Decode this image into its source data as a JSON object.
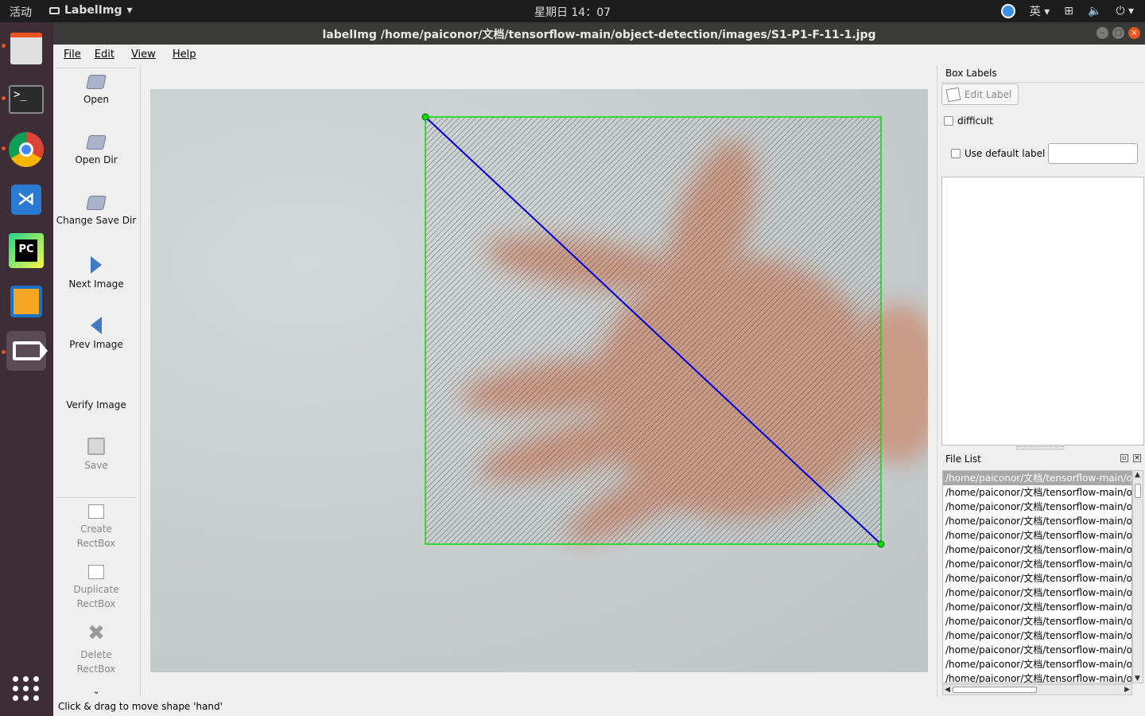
{
  "system": {
    "activities": "活动",
    "app_name": "LabelImg",
    "clock": "星期日 14：07",
    "input_method": "英"
  },
  "window": {
    "title": "labelImg /home/paiconor/文档/tensorflow-main/object-detection/images/S1-P1-F-11-1.jpg"
  },
  "menu": {
    "file": "File",
    "edit": "Edit",
    "view": "View",
    "help": "Help"
  },
  "toolbar": {
    "open": "Open",
    "open_dir": "Open Dir",
    "change_save_dir": "Change Save Dir",
    "next_image": "Next Image",
    "prev_image": "Prev Image",
    "verify_image": "Verify Image",
    "save": "Save",
    "create_rectbox_1": "Create",
    "create_rectbox_2": "RectBox",
    "duplicate_rectbox_1": "Duplicate",
    "duplicate_rectbox_2": "RectBox",
    "delete_rectbox_1": "Delete",
    "delete_rectbox_2": "RectBox",
    "more": "⌄"
  },
  "box_labels": {
    "title": "Box Labels",
    "edit_label": "Edit Label",
    "difficult": "difficult",
    "use_default_label": "Use default label",
    "default_label_value": ""
  },
  "file_list": {
    "title": "File List",
    "items": [
      "/home/paiconor/文档/tensorflow-main/ob",
      "/home/paiconor/文档/tensorflow-main/ob",
      "/home/paiconor/文档/tensorflow-main/ob",
      "/home/paiconor/文档/tensorflow-main/ob",
      "/home/paiconor/文档/tensorflow-main/ob",
      "/home/paiconor/文档/tensorflow-main/ob",
      "/home/paiconor/文档/tensorflow-main/ob",
      "/home/paiconor/文档/tensorflow-main/ob",
      "/home/paiconor/文档/tensorflow-main/ob",
      "/home/paiconor/文档/tensorflow-main/ob",
      "/home/paiconor/文档/tensorflow-main/ob",
      "/home/paiconor/文档/tensorflow-main/ob",
      "/home/paiconor/文档/tensorflow-main/ob",
      "/home/paiconor/文档/tensorflow-main/ob",
      "/home/paiconor/文档/tensorflow-main/ob"
    ]
  },
  "status": {
    "message": "Click & drag to move shape 'hand'"
  },
  "colors": {
    "box_border": "#00e000",
    "diagonal": "#0000dd",
    "accent": "#e95420"
  }
}
